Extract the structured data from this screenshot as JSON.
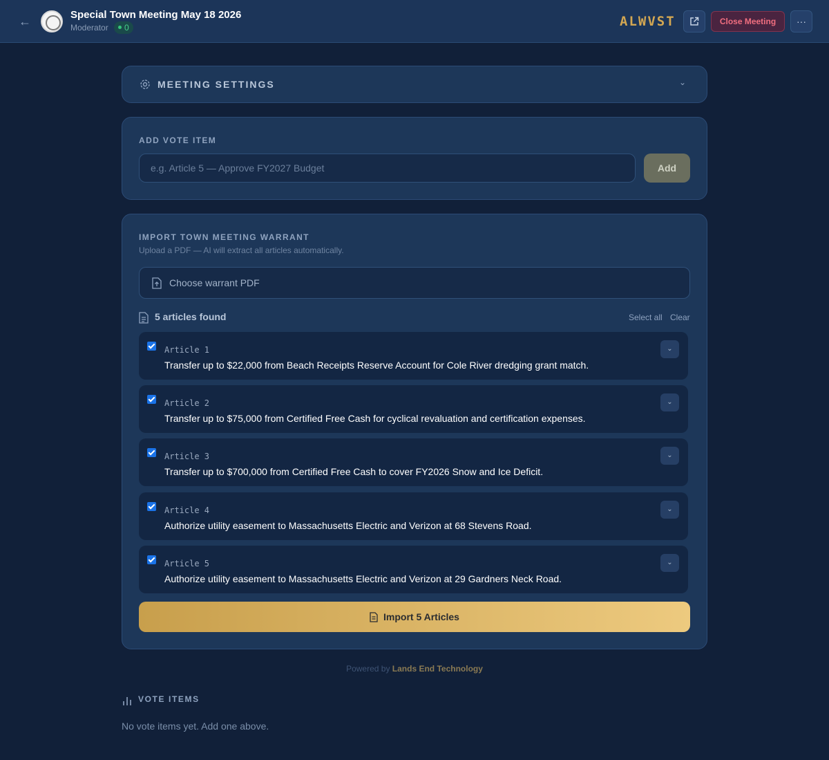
{
  "header": {
    "title": "Special Town Meeting May 18 2026",
    "role": "Moderator",
    "connected_count": "0",
    "brand": "ALWVST",
    "close_label": "Close Meeting"
  },
  "settings": {
    "label": "MEETING SETTINGS"
  },
  "add_vote": {
    "label": "ADD VOTE ITEM",
    "placeholder": "e.g. Article 5 — Approve FY2027 Budget",
    "value": "",
    "button": "Add"
  },
  "import": {
    "title": "IMPORT TOWN MEETING WARRANT",
    "subtitle": "Upload a PDF — AI will extract all articles automatically.",
    "file_label": "Choose warrant PDF",
    "found_label": "5 articles found",
    "select_all": "Select all",
    "clear": "Clear",
    "articles": [
      {
        "number": "Article 1",
        "text": "Transfer up to $22,000 from Beach Receipts Reserve Account for Cole River dredging grant match.",
        "checked": true
      },
      {
        "number": "Article 2",
        "text": "Transfer up to $75,000 from Certified Free Cash for cyclical revaluation and certification expenses.",
        "checked": true
      },
      {
        "number": "Article 3",
        "text": "Transfer up to $700,000 from Certified Free Cash to cover FY2026 Snow and Ice Deficit.",
        "checked": true
      },
      {
        "number": "Article 4",
        "text": "Authorize utility easement to Massachusetts Electric and Verizon at 68 Stevens Road.",
        "checked": true
      },
      {
        "number": "Article 5",
        "text": "Authorize utility easement to Massachusetts Electric and Verizon at 29 Gardners Neck Road.",
        "checked": true
      }
    ],
    "import_button": "Import 5 Articles"
  },
  "footer": {
    "prefix": "Powered by",
    "company": "Lands End Technology"
  },
  "vote_items": {
    "label": "VOTE ITEMS",
    "empty": "No vote items yet. Add one above."
  },
  "colors": {
    "accent_gold": "#d3a752",
    "danger": "#f06e7f",
    "online": "#47d18a",
    "background": "#112039"
  }
}
